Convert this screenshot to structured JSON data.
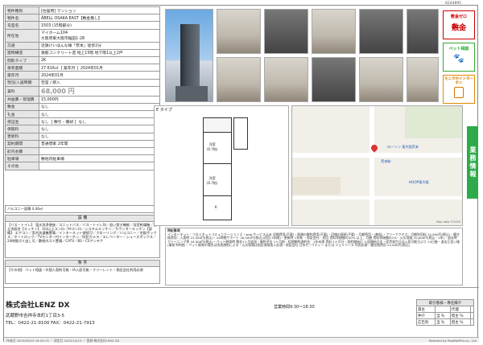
{
  "doc_id": "8244895",
  "info_rows": [
    {
      "k": "物件種目",
      "v": "[住居用] マンション"
    },
    {
      "k": "物件名",
      "v": "ÄBELL OSAKA EAST【敷金無し】"
    },
    {
      "k": "号室名",
      "v": "1503 (15階部分)"
    },
    {
      "k": "所在地",
      "v": "マイホーム104\n大阪府東大阪市稲田1-28"
    },
    {
      "k": "交通",
      "v": "近鉄けいはんな線「荒本」徒歩2分"
    },
    {
      "k": "建物構造",
      "v": "鉄筋コンクリート造 地上15階 地下階1以上2戸"
    },
    {
      "k": "間取タイプ",
      "v": "2K"
    },
    {
      "k": "専有面積",
      "v": "27.616㎡  [ 築年月 ]  2024年01月"
    },
    {
      "k": "築年月",
      "v": "2024年01月"
    },
    {
      "k": "現況/入居時期",
      "v": "空室 / 即入"
    },
    {
      "k": "賃料",
      "v": "68,000 円"
    },
    {
      "k": "共益費・管理費",
      "v": "15,000円"
    },
    {
      "k": "敷金",
      "v": "なし"
    },
    {
      "k": "礼金",
      "v": "なし"
    },
    {
      "k": "保証金",
      "v": "なし  [ 敷引・償却 ]  なし"
    },
    {
      "k": "保険料",
      "v": "なし"
    },
    {
      "k": "更新料",
      "v": "なし"
    },
    {
      "k": "契約期間",
      "v": "普通借家 2年間"
    },
    {
      "k": "町内会費",
      "v": ""
    },
    {
      "k": "駐車場",
      "v": "敷地内駐車場"
    },
    {
      "k": "その他",
      "v": ""
    }
  ],
  "balcony": "バルコニー面積 4.46㎡",
  "equipment_head": "設 備",
  "equipment_text": "【バス・トイレ】 温水洗浄便座／ユニットバス／バス・トイレ別／追い焚き機能／浴室乾燥機／独立洗面台【キッチン】 2口以上コンロ／IHコンロ／システムキッチン／カウンターキッチン【設備】 エアコン／室内洗濯機置場／インターネット接続可／フローリング／バルコニー／宅配ボックス／オートロック／TVモニター付インターホン／防犯カメラ／エレベーター／シューズボックス／24時間ゴミ出し可／敷地内ゴミ置場／CATV／BS・CSアンテナ",
  "conditions_head": "条 件",
  "conditions_text": "【その他】 ペット相談・外国人契約可能・IA入居可能・フリーレント・保証会社利用必須",
  "floorplan_caption": "E タイプ",
  "floorplan_labels": {
    "room1": "洋室\n(6.7帖)",
    "room2": "洋室\n(6.7帖)",
    "kitchen": "K"
  },
  "map_labels": {
    "station": "荒本駅",
    "lawson": "ローソン 東大阪荒本",
    "hoop": "HOOP東大阪",
    "credit": "Map data ©2025"
  },
  "badges": [
    {
      "label": "敷金ゼロ"
    },
    {
      "label": "ペット相談"
    },
    {
      "label": "モニタ付インターホン"
    }
  ],
  "side_tab": "業務情報",
  "notes_head": "特記事項",
  "notes_text": "インターネット：つなぐネットコミュニケーションズ・web サービス込み 初期費用(不要)・配備の解約費用(不要)・回線の接続(不要)・月額費用・(無料)・フリーアクセス：月額利用料 15,000円(税込)・鍵交換費用：入居時 22,000円(税込)・24時間サポート 16,500円(税込)(初回 2年間)・更新時 1年毎 ・保証会社：初回 賃料等総額の50% 以上、月額 賃料等総額の1%・火災保険 20,000円(税込・2年)・退去時 クリーニング費 44,000円(税込)・ペット飼育時 敷金1ヶ月追加・解約予告 1ヶ月前・短期解約違約金：1年未満 賃料 1ヶ月分・契約開始日 入居開始日迄・家賃発生日は入居可能日より 14日後・退去立会い後 (事前予約制)・ペット飼育の場合は別途規約による・火災保険は指定保険加入必須・保証会社 日本セーフティー または ジェイリース 利用必須・鍵交換費用 22,000円(税込)",
  "company": "株式会社LENZ DX",
  "address": "武蔵野市吉祥寺本町1丁目3-5",
  "tel": "TEL：0422-21-9100  FAX：0422-21-7913",
  "hours": "営業時間9:30～18:30",
  "terms": {
    "title": "取引態様・専任媒介",
    "rows": [
      [
        "貸主",
        "",
        "代理",
        ""
      ],
      [
        "仲介",
        "当 ％",
        "借主 ％",
        ""
      ],
      [
        "広告料",
        "当 ％",
        "借主 ％",
        ""
      ]
    ]
  },
  "footer_left": "作成日 2025/09/29 16:09:15 ／ 改定日 2025/10/13 ／ 登録 株式会社LENZ DX",
  "footer_right": "Powered by RealNetPro.co., Ltd"
}
